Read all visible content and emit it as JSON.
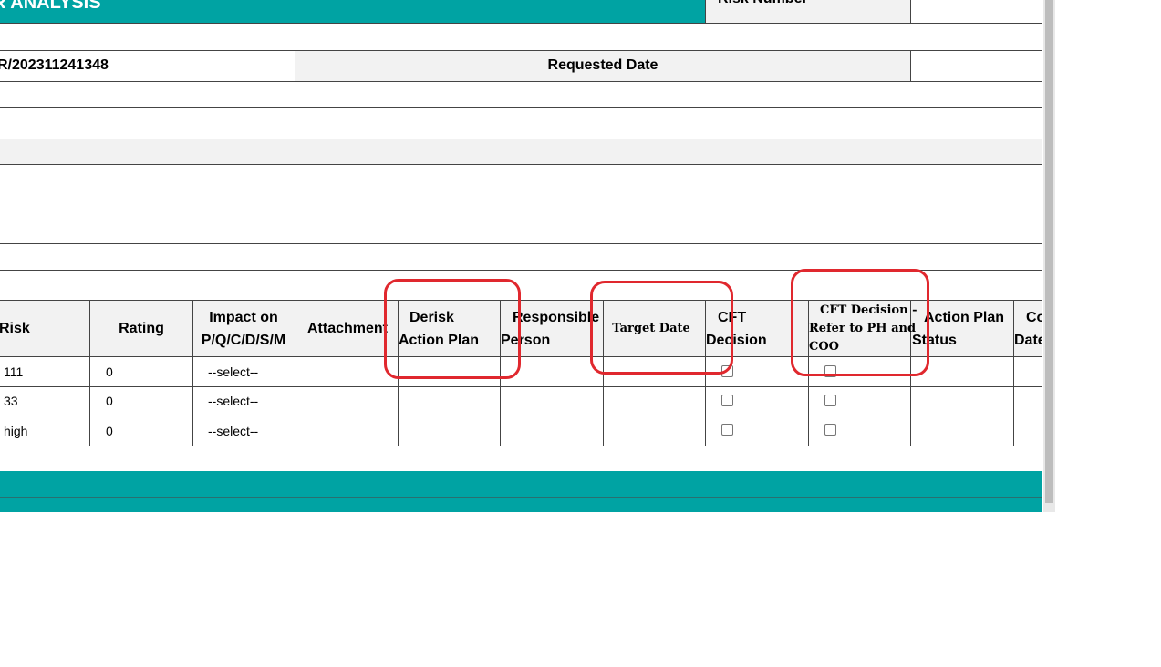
{
  "header": {
    "title": "R ANALYSIS",
    "risk_number_label": "Risk Number"
  },
  "info": {
    "request_no": "R/202311241348",
    "requested_date_label": "Requested Date"
  },
  "table": {
    "headers": {
      "risk": "Risk",
      "rating": "Rating",
      "impact_line1": "Impact on",
      "impact_line2": "P/Q/C/D/S/M",
      "attachment": "Attachment",
      "derisk_line1": "Derisk",
      "derisk_line2": "Action Plan",
      "responsible_line1": "Responsible",
      "responsible_line2": "Person",
      "target_date": "Target Date",
      "cft_line1": "CFT",
      "cft_line2": "Decision",
      "cft_refer_line1": "CFT Decision -",
      "cft_refer_line2": "Refer to PH and",
      "cft_refer_line3": "COO",
      "ap_status_line1": "Action Plan",
      "ap_status_line2": "Status",
      "comp_line1": "Co",
      "comp_line2": "Date"
    },
    "rows": [
      {
        "risk": "111",
        "rating": "0",
        "impact": "--select--"
      },
      {
        "risk": "33",
        "rating": "0",
        "impact": "--select--"
      },
      {
        "risk": "high",
        "rating": "0",
        "impact": "--select--"
      }
    ]
  },
  "colors": {
    "teal": "#00a3a3",
    "header_gray": "#f2f2f2",
    "highlight_red": "#e0282e"
  }
}
